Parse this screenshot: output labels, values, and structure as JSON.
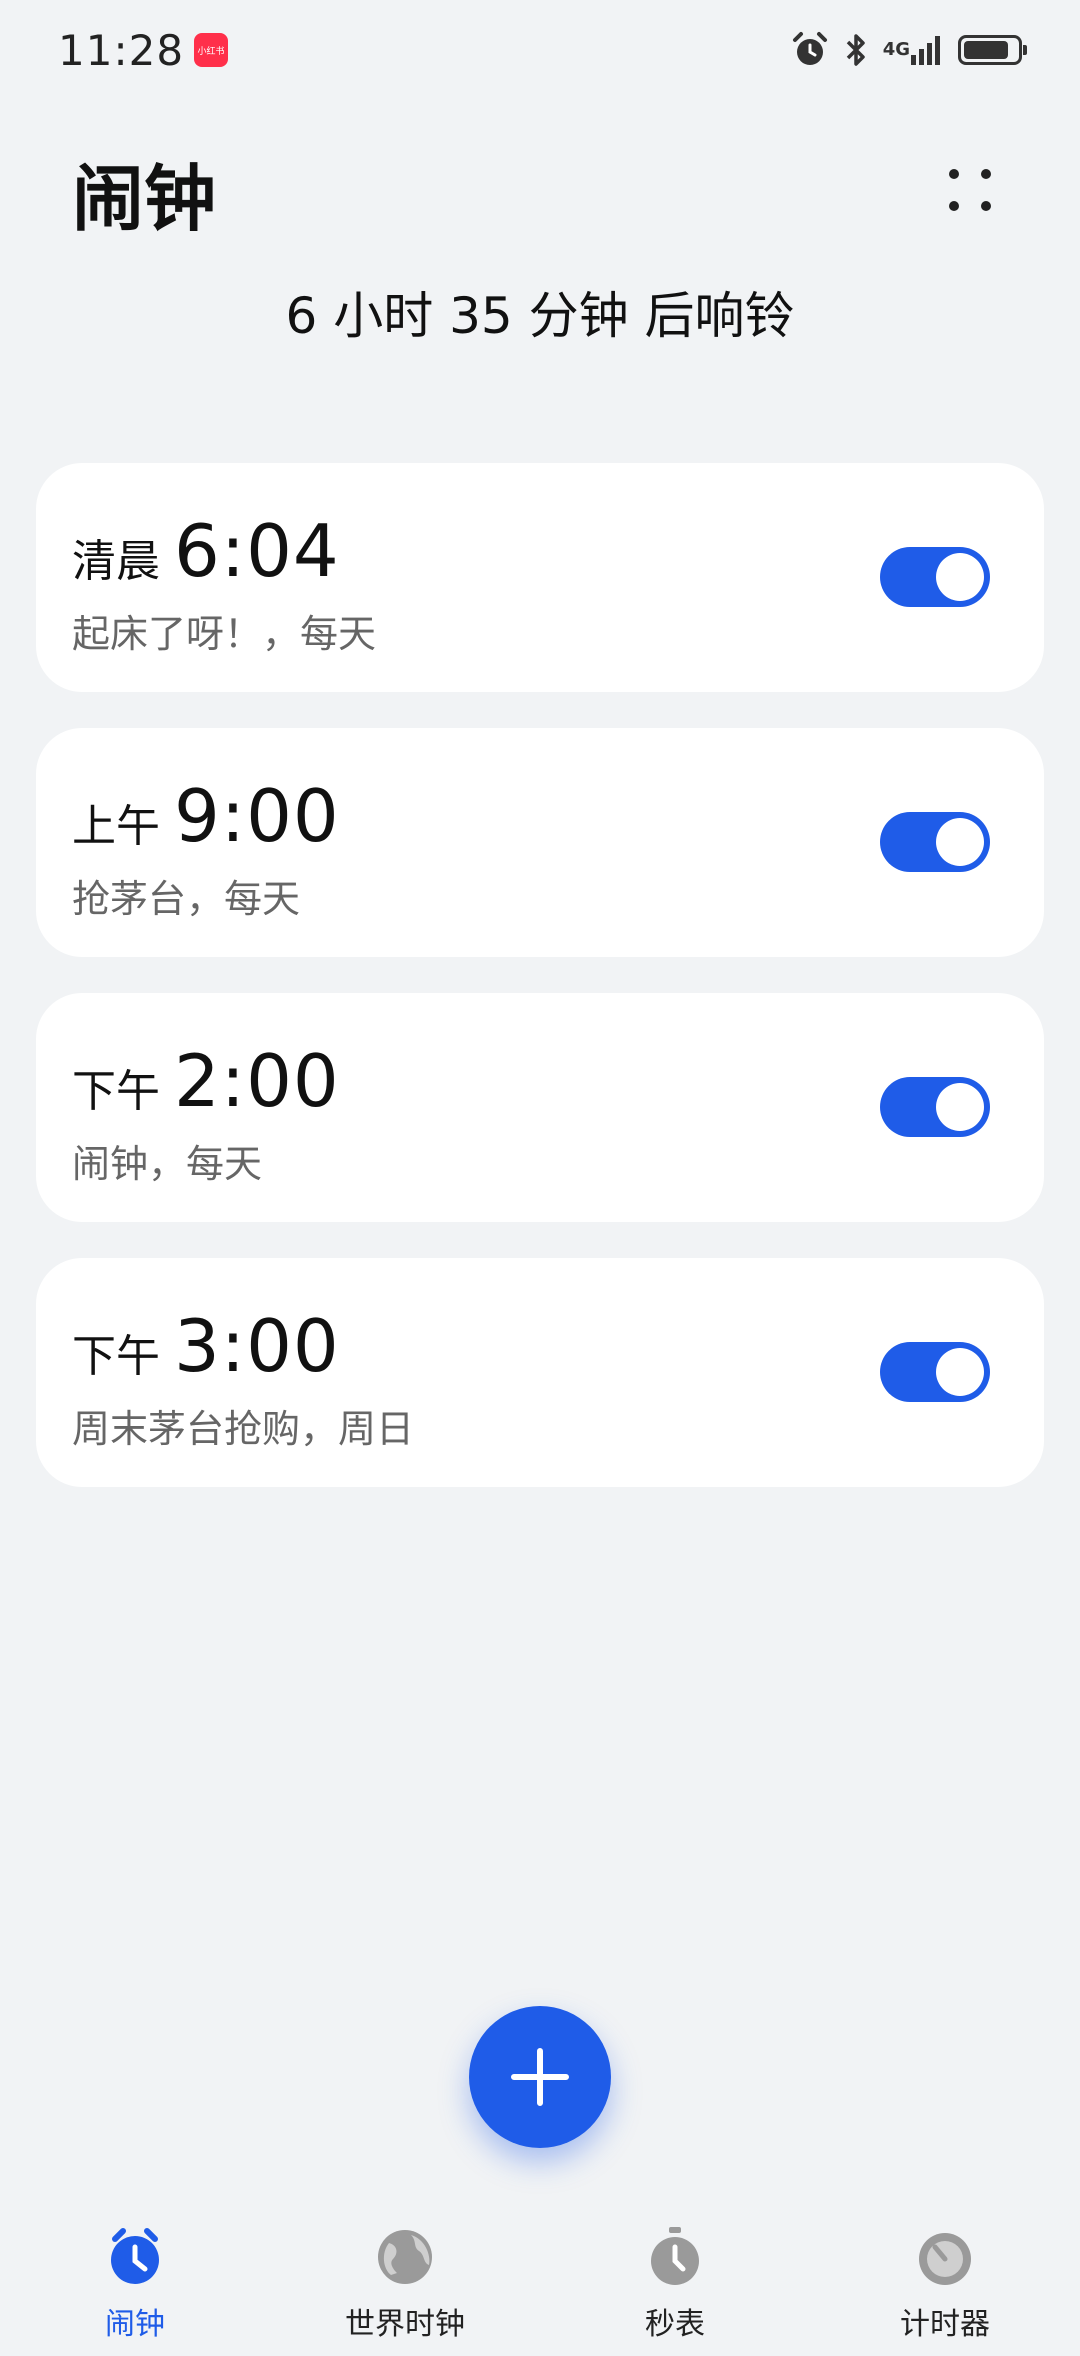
{
  "status_bar": {
    "time": "11:28",
    "app_badge": "小红书",
    "network": "4G",
    "battery_level": 0.85
  },
  "header": {
    "title": "闹钟",
    "next_ring": "6 小时 35 分钟 后响铃"
  },
  "alarms": [
    {
      "period": "清晨",
      "time": "6:04",
      "desc": "起床了呀！，每天",
      "enabled": true
    },
    {
      "period": "上午",
      "time": "9:00",
      "desc": "抢茅台，每天",
      "enabled": true
    },
    {
      "period": "下午",
      "time": "2:00",
      "desc": "闹钟，每天",
      "enabled": true
    },
    {
      "period": "下午",
      "time": "3:00",
      "desc": "周末茅台抢购，周日",
      "enabled": true
    }
  ],
  "nav": {
    "items": [
      {
        "label": "闹钟",
        "icon": "alarm-clock-icon",
        "active": true
      },
      {
        "label": "世界时钟",
        "icon": "globe-icon",
        "active": false
      },
      {
        "label": "秒表",
        "icon": "stopwatch-icon",
        "active": false
      },
      {
        "label": "计时器",
        "icon": "timer-icon",
        "active": false
      }
    ]
  },
  "colors": {
    "accent": "#1f5ce8",
    "background": "#f1f3f5",
    "card": "#ffffff",
    "inactive_icon": "#9a9a9a"
  }
}
